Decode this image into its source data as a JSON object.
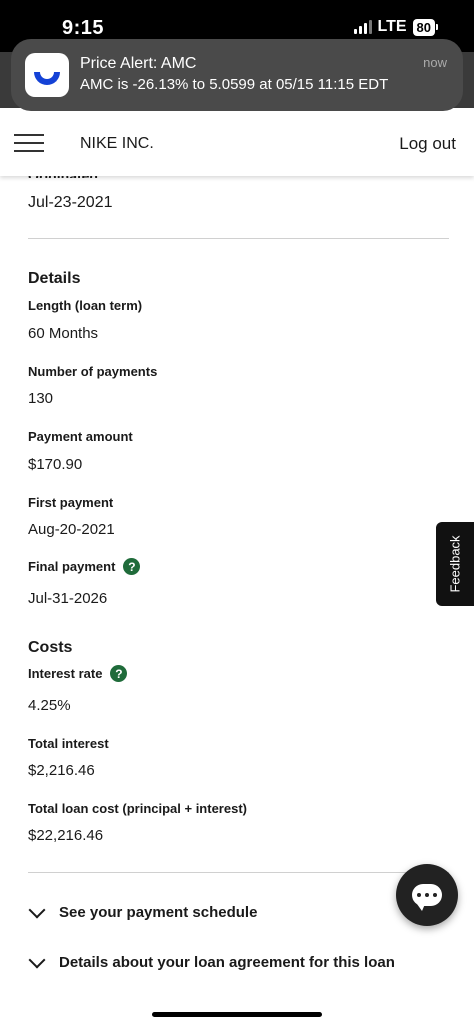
{
  "status_bar": {
    "time": "9:15",
    "network": "LTE",
    "battery": "80"
  },
  "notification": {
    "title": "Price Alert: AMC",
    "body": "AMC is -26.13% to 5.0599 at 05/15 11:15 EDT",
    "time": "now",
    "icon": "app-smile-logo-icon"
  },
  "header": {
    "company": "NIKE INC.",
    "logout_label": "Log out",
    "menu_icon": "hamburger-menu-icon"
  },
  "origination": {
    "label": "Originated",
    "value": "Jul-23-2021"
  },
  "details": {
    "heading": "Details",
    "items": [
      {
        "label": "Length (loan term)",
        "value": "60 Months"
      },
      {
        "label": "Number of payments",
        "value": "130"
      },
      {
        "label": "Payment amount",
        "value": "$170.90"
      },
      {
        "label": "First payment",
        "value": "Aug-20-2021"
      },
      {
        "label": "Final payment",
        "value": "Jul-31-2026"
      }
    ]
  },
  "costs": {
    "heading": "Costs",
    "items": [
      {
        "label": "Interest rate",
        "value": "4.25%"
      },
      {
        "label": "Total interest",
        "value": "$2,216.46"
      },
      {
        "label": "Total loan cost (principal + interest)",
        "value": "$22,216.46"
      }
    ]
  },
  "help_glyph": "?",
  "links": {
    "schedule": "See your payment schedule",
    "agreement": "Details about your loan agreement for this loan"
  },
  "feedback_label": "Feedback",
  "colors": {
    "help_badge": "#1f6b3a",
    "notification_bg": "#4a4a4a",
    "brand_blue": "#1442d6"
  }
}
